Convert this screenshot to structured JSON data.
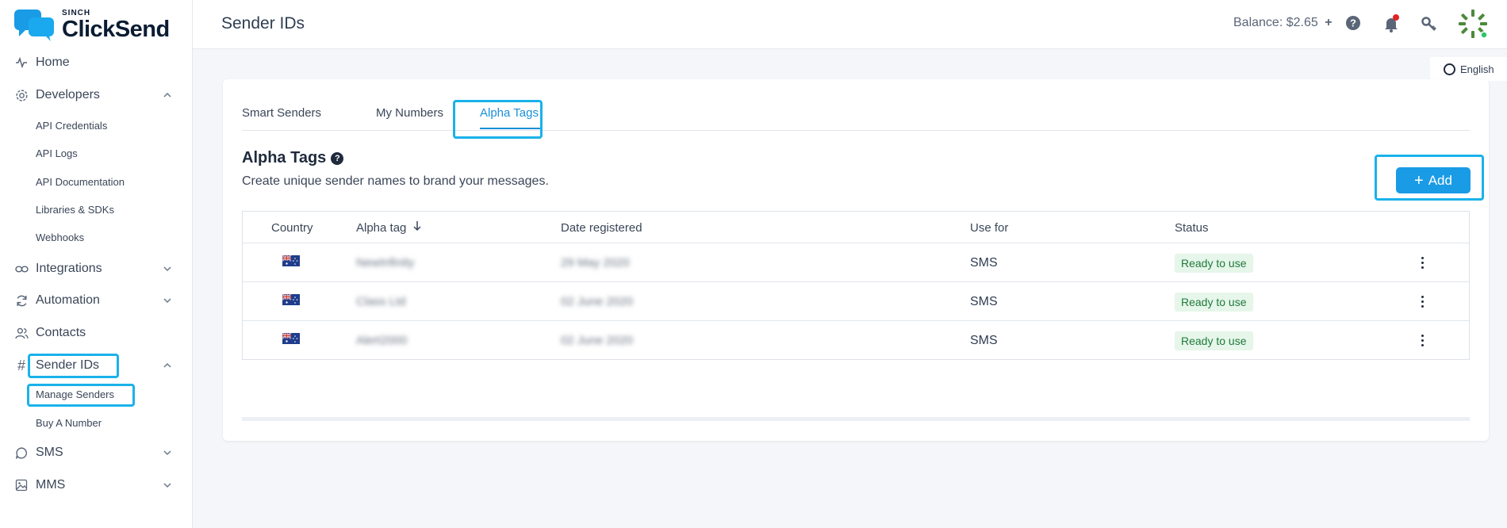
{
  "brand": {
    "small": "SINCH",
    "name": "ClickSend"
  },
  "header": {
    "title": "Sender IDs",
    "balance": "Balance: $2.65"
  },
  "language": "English",
  "sidebar": {
    "items": [
      {
        "label": "Home",
        "icon": "activity-icon"
      },
      {
        "label": "Developers",
        "icon": "gear-icon",
        "expanded": true,
        "subitems": [
          "API Credentials",
          "API Logs",
          "API Documentation",
          "Libraries & SDKs",
          "Webhooks"
        ]
      },
      {
        "label": "Integrations",
        "icon": "link-icon"
      },
      {
        "label": "Automation",
        "icon": "refresh-icon"
      },
      {
        "label": "Contacts",
        "icon": "users-icon"
      },
      {
        "label": "Sender IDs",
        "icon": "hash-icon",
        "expanded": true,
        "subitems": [
          "Manage Senders",
          "Buy A Number"
        ]
      },
      {
        "label": "SMS",
        "icon": "chat-bubble-icon"
      },
      {
        "label": "MMS",
        "icon": "image-icon"
      }
    ]
  },
  "tabs": [
    "Smart Senders",
    "My Numbers",
    "Alpha Tags"
  ],
  "active_tab": "Alpha Tags",
  "section": {
    "title": "Alpha Tags",
    "description": "Create unique sender names to brand your messages.",
    "add_label": "Add"
  },
  "table": {
    "headers": [
      "Country",
      "Alpha tag",
      "Date registered",
      "Use for",
      "Status"
    ],
    "rows": [
      {
        "country": "AU",
        "alpha_tag": "NewInfinity",
        "date": "29 May 2020",
        "use_for": "SMS",
        "status": "Ready to use"
      },
      {
        "country": "AU",
        "alpha_tag": "Class Ltd",
        "date": "02 June 2020",
        "use_for": "SMS",
        "status": "Ready to use"
      },
      {
        "country": "AU",
        "alpha_tag": "Alert2000",
        "date": "02 June 2020",
        "use_for": "SMS",
        "status": "Ready to use"
      }
    ]
  },
  "colors": {
    "accent": "#1a9be6",
    "highlight": "#1ab2ea",
    "status_bg": "#e6f6ea",
    "status_text": "#1f7a3a",
    "notification_dot": "#e02424"
  }
}
